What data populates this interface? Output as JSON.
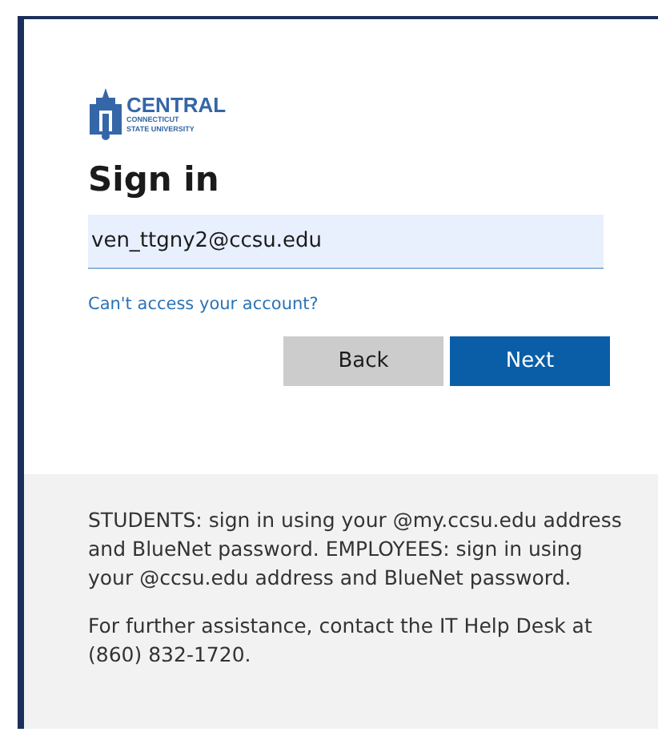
{
  "logo": {
    "name": "CENTRAL",
    "line_1": "CONNECTICUT",
    "line_2": "STATE UNIVERSITY"
  },
  "title": "Sign in",
  "email_field": {
    "value": "ven_ttgny2@ccsu.edu"
  },
  "link": "Can't access your account?",
  "buttons": [
    {
      "label": "Back",
      "kind": "secondary"
    },
    {
      "label": "Next",
      "kind": "primary"
    }
  ],
  "notes": [
    "STUDENTS: sign in using your @my.ccsu.edu address and BlueNet password. EMPLOYEES: sign in using your @ccsu.edu address and BlueNet password.",
    "For further assistance, contact the IT Help Desk at (860) 832-1720."
  ]
}
